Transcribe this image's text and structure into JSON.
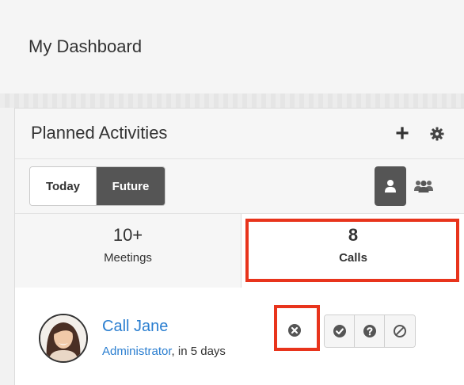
{
  "page": {
    "title": "My Dashboard"
  },
  "dashlet": {
    "title": "Planned Activities",
    "filters": {
      "today_label": "Today",
      "future_label": "Future",
      "selected": "Future"
    },
    "view_selected": "user"
  },
  "tabs": [
    {
      "count": "10+",
      "label": "Meetings"
    },
    {
      "count": "8",
      "label": "Calls"
    }
  ],
  "item": {
    "title": "Call Jane",
    "assigned": "Administrator",
    "when": ", in 5 days"
  },
  "colors": {
    "link": "#2a7ed0",
    "highlight": "#e8341c",
    "active": "#555555"
  },
  "icons": [
    "plus-icon",
    "gear-icon",
    "user-icon",
    "group-icon",
    "close-circle-icon",
    "check-circle-icon",
    "question-circle-icon",
    "ban-icon"
  ]
}
